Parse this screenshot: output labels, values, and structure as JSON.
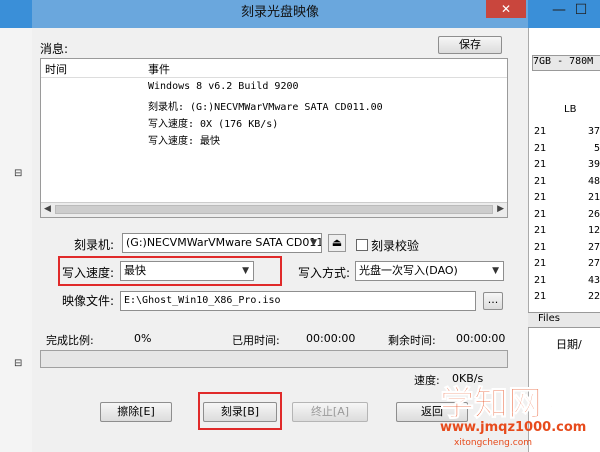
{
  "background_app": {
    "capacity_text": "7GB - 780M",
    "column_label": "LB",
    "rows": [
      {
        "a": "21",
        "b": "37"
      },
      {
        "a": "21",
        "b": "5"
      },
      {
        "a": "21",
        "b": "39"
      },
      {
        "a": "21",
        "b": "48"
      },
      {
        "a": "21",
        "b": "21"
      },
      {
        "a": "21",
        "b": "26"
      },
      {
        "a": "21",
        "b": "12"
      },
      {
        "a": "21",
        "b": "27"
      },
      {
        "a": "21",
        "b": "27"
      },
      {
        "a": "21",
        "b": "43"
      },
      {
        "a": "21",
        "b": "22"
      }
    ],
    "files_label": "Files",
    "date_label": "日期/"
  },
  "dialog": {
    "title": "刻录光盘映像",
    "close_glyph": "✕",
    "messages_label": "消息:",
    "save_button": "保存",
    "log": {
      "col_time": "时间",
      "col_event": "事件",
      "lines": [
        "Windows 8 v6.2 Build 9200",
        "刻录机: (G:)NECVMWarVMware SATA CD011.00",
        "写入速度: 0X (176 KB/s)",
        "写入速度: 最快"
      ]
    },
    "burner_label": "刻录机:",
    "burner_value": "(G:)NECVMWarVMware SATA CD011.00",
    "verify_label": "刻录校验",
    "write_speed_label": "写入速度:",
    "write_speed_value": "最快",
    "write_method_label": "写入方式:",
    "write_method_value": "光盘一次写入(DAO)",
    "image_file_label": "映像文件:",
    "image_file_value": "E:\\Ghost_Win10_X86_Pro.iso",
    "browse_button": "...",
    "progress_label": "完成比例:",
    "progress_value": "0%",
    "progress_fraction": 0,
    "elapsed_label": "已用时间:",
    "elapsed_value": "00:00:00",
    "remaining_label": "剩余时间:",
    "remaining_value": "00:00:00",
    "speed_label": "速度:",
    "speed_value": "0KB/s",
    "buttons": {
      "erase": "擦除[E]",
      "burn": "刻录[B]",
      "stop": "终止[A]",
      "back": "返回"
    }
  },
  "watermark": {
    "brand": "学知网",
    "url": "www.jmqz1000.com",
    "site2": "xitongcheng.com",
    "brand2": "统城"
  },
  "colors": {
    "highlight": "#e02a2a",
    "title_bar": "#6aa7dd",
    "close_button": "#c9463d",
    "watermark": "#e74b1c"
  }
}
